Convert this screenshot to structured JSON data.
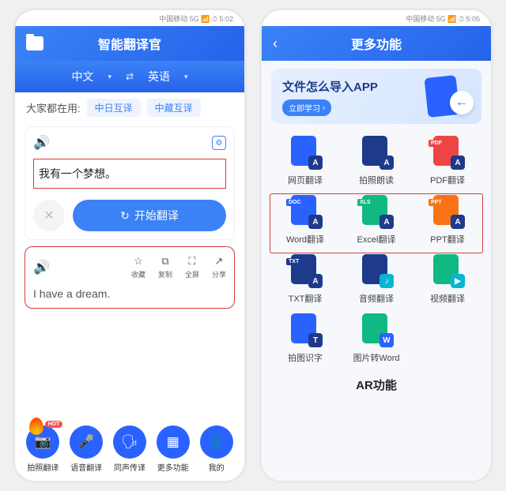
{
  "p1": {
    "status": "中国移动  5G  📶  ⏱ 5:02",
    "title": "智能翻译官",
    "lang": {
      "from": "中文",
      "to": "英语"
    },
    "popular": {
      "label": "大家都在用:",
      "tags": [
        "中日互译",
        "中藏互译"
      ]
    },
    "input": "我有一个梦想。",
    "start": "开始翻译",
    "tools": {
      "fav": "收藏",
      "copy": "复制",
      "full": "全屏",
      "share": "分享"
    },
    "result": "I have a dream.",
    "nav": {
      "photo": "拍照翻译",
      "voice": "语音翻译",
      "live": "同声传译",
      "more": "更多功能",
      "mine": "我的"
    },
    "hot": "HOT"
  },
  "p2": {
    "status": "中国移动  5G  📶  ⏱ 5:05",
    "title": "更多功能",
    "banner": {
      "title": "文件怎么导入APP",
      "btn": "立即学习"
    },
    "items": {
      "web": "网页翻译",
      "photo_read": "拍照朗读",
      "pdf": "PDF翻译",
      "word": "Word翻译",
      "excel": "Excel翻译",
      "ppt": "PPT翻译",
      "txt": "TXT翻译",
      "audio": "音频翻译",
      "video": "视频翻译",
      "ocr": "拍图识字",
      "img2word": "图片转Word"
    },
    "section": "AR功能"
  }
}
